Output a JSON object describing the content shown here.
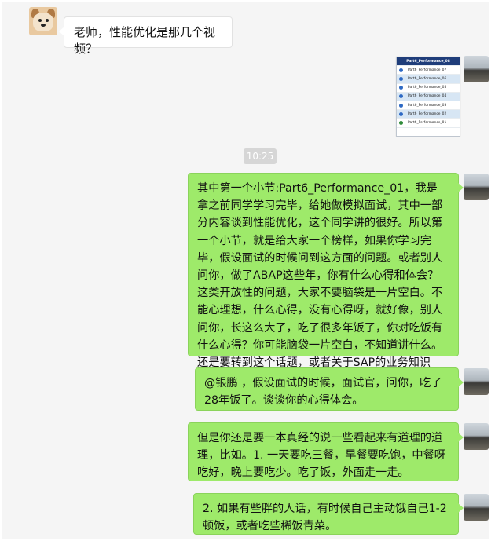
{
  "left_message": {
    "text": "老师，性能优化是那几个视频？"
  },
  "file_card": {
    "header": "Part6_Performance_08",
    "rows": [
      "Part6_Performance_07",
      "Part6_Performance_06",
      "Part6_Performance_05",
      "Part6_Performance_04",
      "Part6_Performance_03",
      "Part6_Performance_02",
      "Part6_Performance_01"
    ]
  },
  "timestamp": "10:25",
  "right_messages": [
    {
      "text": "其中第一个小节:Part6_Performance_01，我是拿之前同学学习完毕，给她做模拟面试，其中一部分内容谈到性能优化，这个同学讲的很好。所以第一个小节，就是给大家一个榜样，如果你学习完毕，假设面试的时候问到这方面的问题。或者别人问你，做了ABAP这些年，你有什么心得和体会？这类开放性的问题，大家不要脑袋是一片空白。不能心理想，什么心得，没有心得呀，就好像，别人问你，长这么大了，吃了很多年饭了，你对吃饭有什么心得？你可能脑袋一片空白，不知道讲什么。还是要转到这个话题，或者关于SAP的业务知识上。当然你"
    },
    {
      "text": "@银鹏 ，假设面试的时候，面试官，问你，吃了28年饭了。谈谈你的心得体会。"
    },
    {
      "text": "但是你还是要一本真经的说一些看起来有道理的道理，比如。1. 一天要吃三餐，早餐要吃饱，中餐呀吃好，晚上要吃少。吃了饭，外面走一走。"
    },
    {
      "text": "2. 如果有些胖的人话，有时候自己主动饿自己1-2顿饭，或者吃些稀饭青菜。"
    }
  ]
}
